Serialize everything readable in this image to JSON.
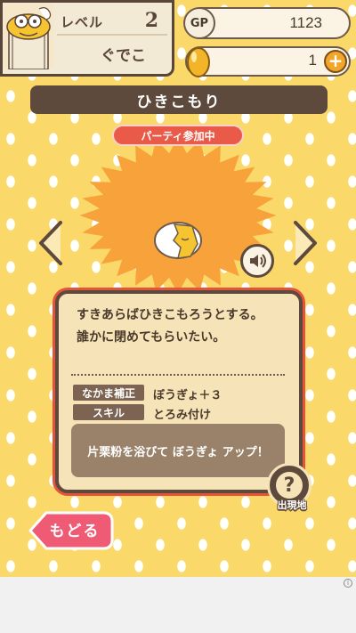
{
  "player": {
    "level_label": "レベル",
    "level": "2",
    "name": "ぐでこ"
  },
  "currency": {
    "gp_label": "GP",
    "gp": "1123",
    "gold_eggs": "1"
  },
  "character": {
    "name": "ひきこもり",
    "party_status": "パーティ参加中",
    "description_line1": "すきあらばひきこもろうとする。",
    "description_line2": "誰かに閉めてもらいたい。",
    "companion_bonus_label": "なかま補正",
    "companion_bonus_value": "ぼうぎょ＋３",
    "skill_label": "スキル",
    "skill_value": "とろみ付け",
    "skill_detail": "片栗粉を浴びて ぼうぎょ アップ！"
  },
  "buttons": {
    "location_label": "出現地",
    "location_symbol": "?",
    "back_label": "もどる",
    "add_symbol": "+"
  },
  "ad": {
    "info_symbol": "i"
  },
  "colors": {
    "background": "#fbd86a",
    "dark_brown": "#5d4a3c",
    "accent_red": "#ea5a48",
    "back_pink": "#ef5a74",
    "starburst": "#f7a23a",
    "gold": "#f2a629"
  }
}
